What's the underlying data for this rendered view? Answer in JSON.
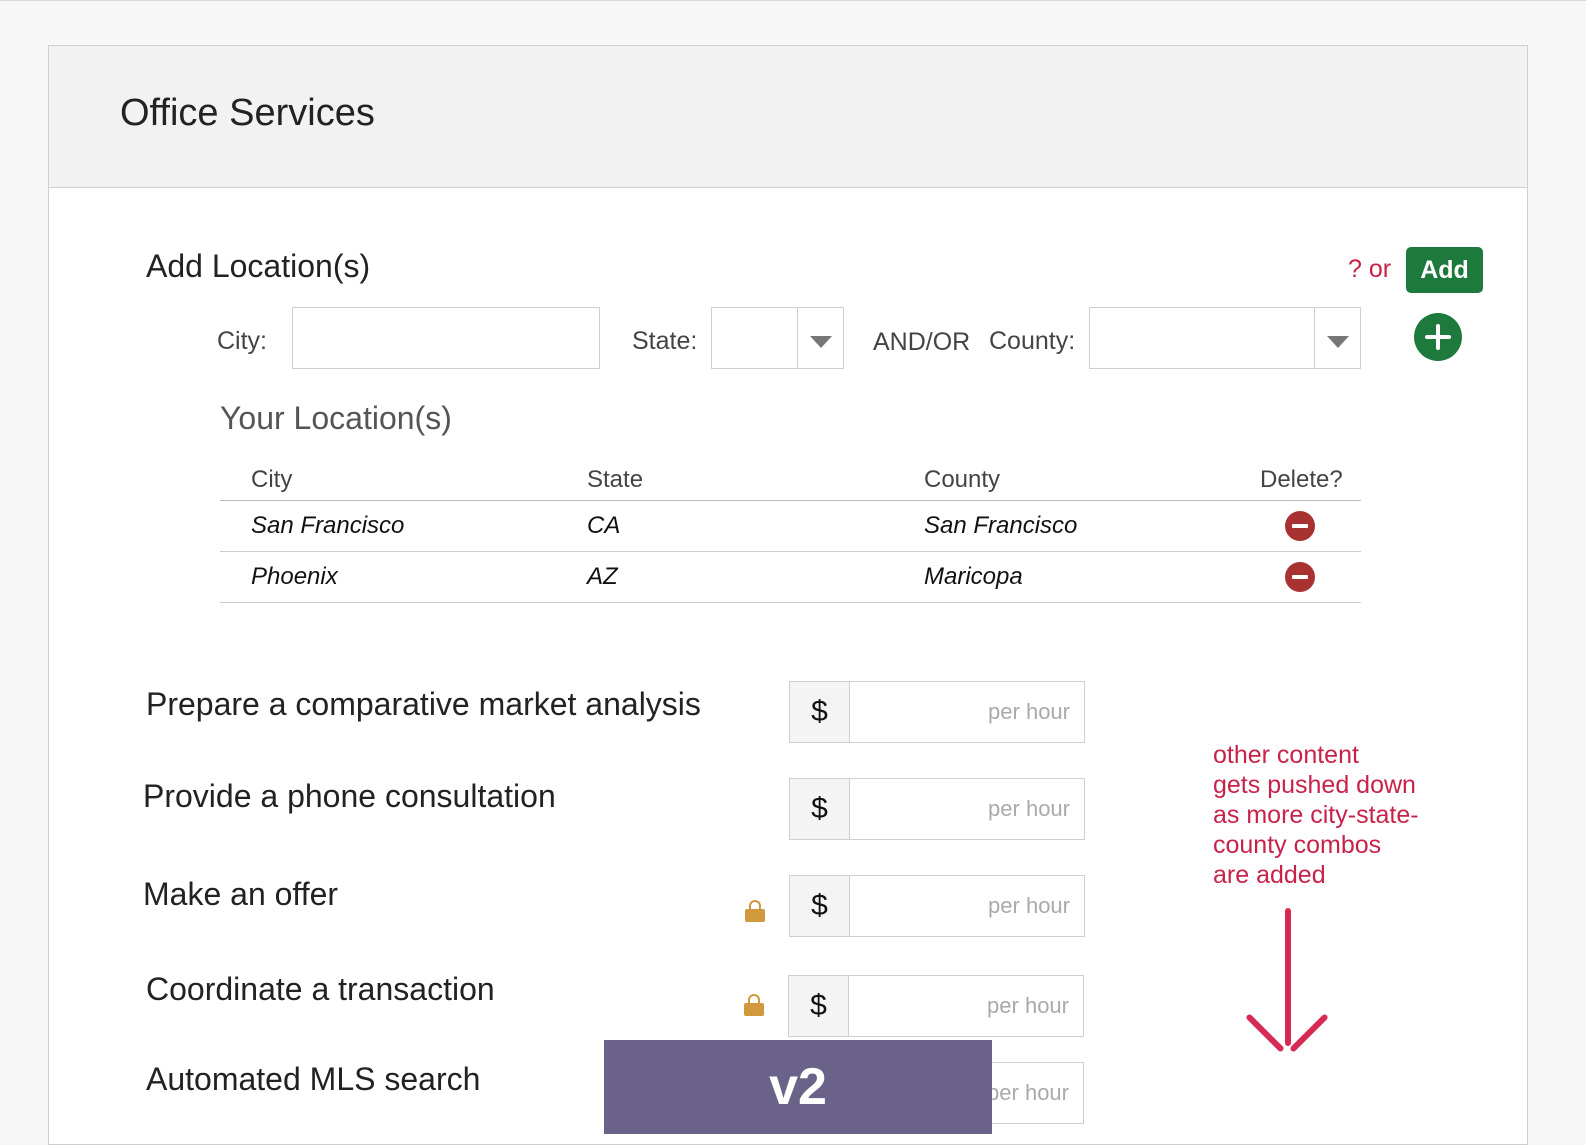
{
  "panel": {
    "title": "Office Services"
  },
  "add_location": {
    "title": "Add Location(s)",
    "help_text": "? or",
    "add_button": "Add",
    "city_label": "City:",
    "city_value": "",
    "state_label": "State:",
    "state_value": "",
    "and_or": "AND/OR",
    "county_label": "County:",
    "county_value": "",
    "icons": {
      "add_row": "plus-circle-icon",
      "dropdown": "chevron-down-icon"
    }
  },
  "your_locations": {
    "title": "Your Location(s)",
    "headers": {
      "city": "City",
      "state": "State",
      "county": "County",
      "delete": "Delete?"
    },
    "rows": [
      {
        "city": "San Francisco",
        "state": "CA",
        "county": "San Francisco"
      },
      {
        "city": "Phoenix",
        "state": "AZ",
        "county": "Maricopa"
      }
    ]
  },
  "services": [
    {
      "label": "Prepare a comparative market analysis",
      "prefix": "$",
      "placeholder": "per hour",
      "locked": false
    },
    {
      "label": "Provide a phone consultation",
      "prefix": "$",
      "placeholder": "per hour",
      "locked": false
    },
    {
      "label": "Make an offer",
      "prefix": "$",
      "placeholder": "per hour",
      "locked": true
    },
    {
      "label": "Coordinate a transaction",
      "prefix": "$",
      "placeholder": "per hour",
      "locked": true
    },
    {
      "label": "Automated MLS search",
      "prefix": "$",
      "placeholder": "per hour",
      "locked": false
    }
  ],
  "annotation": {
    "lines": [
      "other content",
      "gets pushed down",
      "as more city-state-",
      "county combos",
      "are added"
    ],
    "color": "#c8224a"
  },
  "version_badge": "v2",
  "colors": {
    "accent_green": "#1e7a3c",
    "delete_red": "#a83232",
    "lock_gold": "#d09a3c",
    "badge_purple": "#6a6289"
  }
}
